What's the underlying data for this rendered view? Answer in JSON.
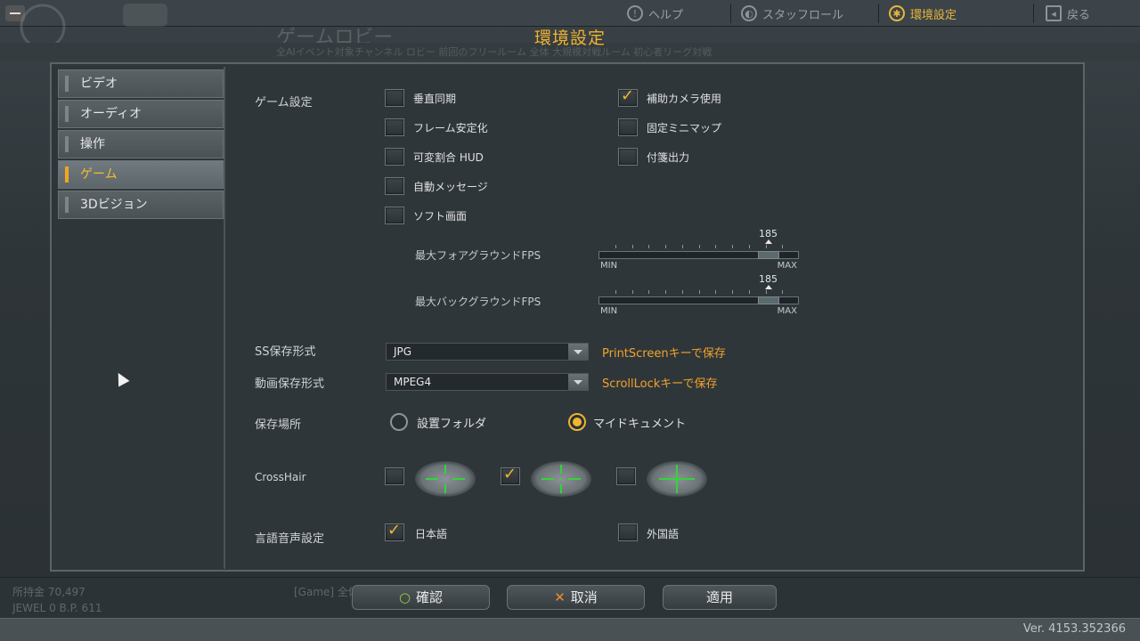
{
  "background": {
    "topnav": [
      {
        "label": "ヘルプ",
        "icon": "help-icon"
      },
      {
        "label": "スタッフロール",
        "icon": "staff-roll-icon"
      },
      {
        "label": "環境設定",
        "icon": "gear-icon",
        "active": true
      },
      {
        "label": "戻る",
        "icon": "back-icon"
      }
    ],
    "lobby_title": "ゲームロビー",
    "strip_text": "全AIイベント対象チャンネル ロビー    前回のフリールーム    全体 大規模対戦ルーム    初心者リーグ対戦",
    "bottom_left_1": "所持金  70,497",
    "bottom_left_2": "JEWEL  0  B.P.  611",
    "bottom_mid": "[Game]    全体",
    "version": "Ver. 4153.352366"
  },
  "dialog": {
    "title": "環境設定",
    "sidebar": [
      {
        "label": "ビデオ",
        "active": false
      },
      {
        "label": "オーディオ",
        "active": false
      },
      {
        "label": "操作",
        "active": false
      },
      {
        "label": "ゲーム",
        "active": true
      },
      {
        "label": "3Dビジョン",
        "active": false
      }
    ],
    "game_settings": {
      "label": "ゲーム設定",
      "left": [
        {
          "label": "垂直同期",
          "checked": false
        },
        {
          "label": "フレーム安定化",
          "checked": false
        },
        {
          "label": "可変割合 HUD",
          "checked": false
        },
        {
          "label": "自動メッセージ",
          "checked": false
        },
        {
          "label": "ソフト画面",
          "checked": false
        }
      ],
      "right": [
        {
          "label": "補助カメラ使用",
          "checked": true
        },
        {
          "label": "固定ミニマップ",
          "checked": false
        },
        {
          "label": "付箋出力",
          "checked": false
        }
      ]
    },
    "fps_foreground": {
      "label": "最大フォアグラウンドFPS",
      "value": "185",
      "fraction": 0.85,
      "min": "MIN",
      "max": "MAX"
    },
    "fps_background": {
      "label": "最大バックグラウンドFPS",
      "value": "185",
      "fraction": 0.85,
      "min": "MIN",
      "max": "MAX"
    },
    "screenshot_format": {
      "label": "SS保存形式",
      "value": "JPG",
      "hint": "PrintScreenキーで保存"
    },
    "video_format": {
      "label": "動画保存形式",
      "value": "MPEG4",
      "hint": "ScrollLockキーで保存"
    },
    "save_location": {
      "label": "保存場所",
      "options": [
        {
          "label": "設置フォルダ",
          "selected": false
        },
        {
          "label": "マイドキュメント",
          "selected": true
        }
      ]
    },
    "crosshair": {
      "label": "CrossHair",
      "options": [
        {
          "style": "gap",
          "checked": false
        },
        {
          "style": "gap-dot",
          "checked": true
        },
        {
          "style": "solid",
          "checked": false
        }
      ]
    },
    "voice_language": {
      "label": "言語音声設定",
      "options": [
        {
          "label": "日本語",
          "checked": true
        },
        {
          "label": "外国語",
          "checked": false
        }
      ]
    },
    "buttons": {
      "confirm": "確認",
      "cancel": "取消",
      "apply": "適用"
    },
    "colors": {
      "accent": "#f2b530",
      "hint": "#f2a22c",
      "crosshair": "#35d33c"
    }
  }
}
